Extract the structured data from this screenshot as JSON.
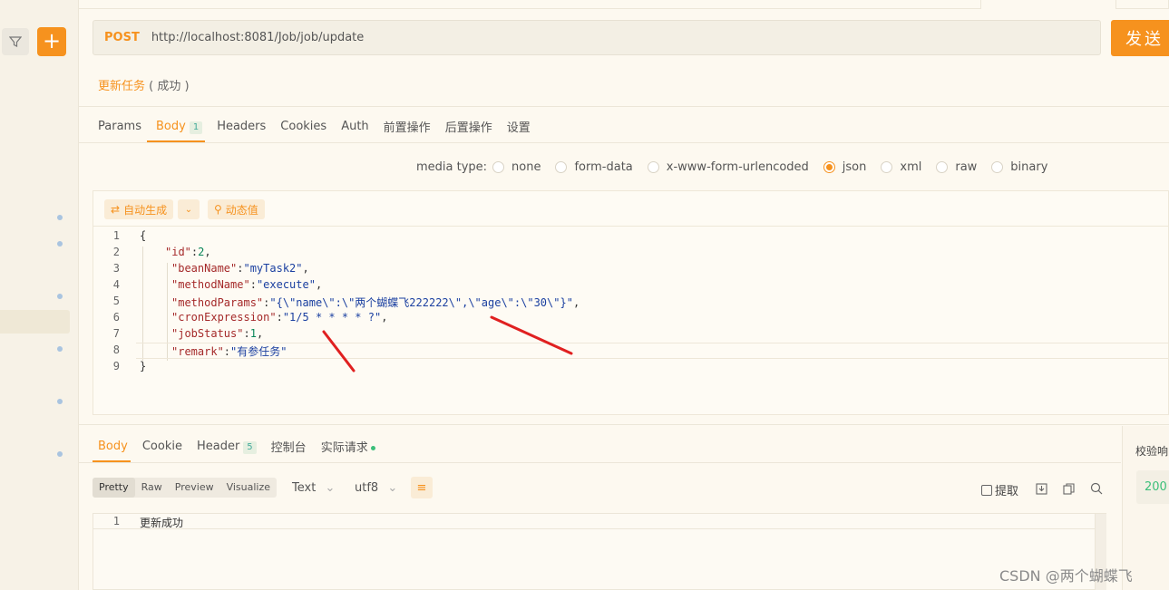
{
  "request": {
    "method": "POST",
    "url": "http://localhost:8081/Job/job/update",
    "send_label": "发送",
    "name": "更新任务",
    "status": "( 成功 )"
  },
  "tabs": [
    {
      "label": "Params"
    },
    {
      "label": "Body",
      "badge": "1",
      "active": true
    },
    {
      "label": "Headers"
    },
    {
      "label": "Cookies"
    },
    {
      "label": "Auth"
    },
    {
      "label": "前置操作"
    },
    {
      "label": "后置操作"
    },
    {
      "label": "设置"
    }
  ],
  "media": {
    "label": "media type:",
    "options": [
      "none",
      "form-data",
      "x-www-form-urlencoded",
      "json",
      "xml",
      "raw",
      "binary"
    ],
    "selected": "json"
  },
  "toolbar": {
    "auto_label": "自动生成",
    "dynamic_label": "动态值"
  },
  "code_lines": [
    "1",
    "2",
    "3",
    "4",
    "5",
    "6",
    "7",
    "8",
    "9"
  ],
  "response": {
    "tabs": [
      {
        "label": "Body",
        "active": true
      },
      {
        "label": "Cookie"
      },
      {
        "label": "Header",
        "badge": "5"
      },
      {
        "label": "控制台"
      },
      {
        "label": "实际请求"
      }
    ],
    "views": [
      "Pretty",
      "Raw",
      "Preview",
      "Visualize"
    ],
    "selected_view": "Pretty",
    "format": "Text",
    "encoding": "utf8",
    "extract_label": "提取",
    "line_number": "1",
    "body_text": "更新成功"
  },
  "right_panel": {
    "label": "校验响",
    "code": "200"
  },
  "watermark": "CSDN @两个蝴蝶飞",
  "colors": {
    "accent": "#f6921e",
    "annotation": "#e02020"
  }
}
